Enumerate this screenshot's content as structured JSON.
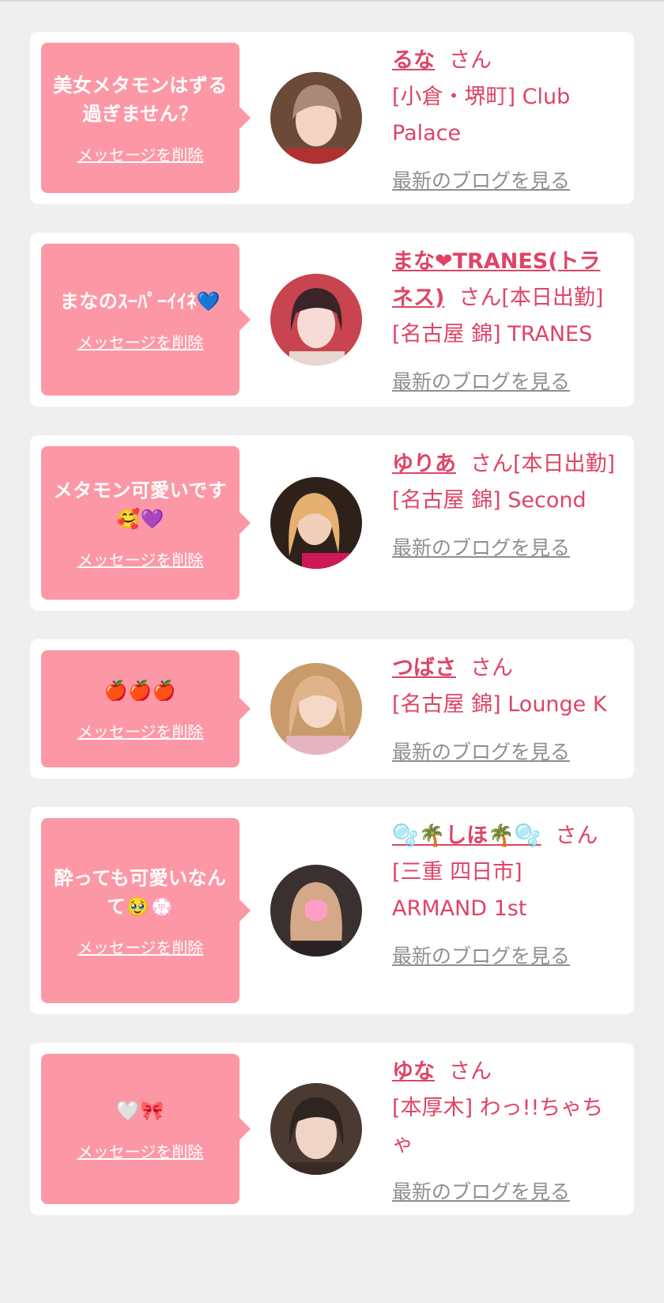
{
  "colors": {
    "bubble": "#fc98a6",
    "text": "#de4466",
    "link": "#8f8f8f",
    "background": "#efefef"
  },
  "cards": [
    {
      "message": "美女メタモンはずる過ぎません？",
      "delete": "メッセージを削除",
      "name": "るな",
      "honorific": "さん",
      "location": "[小倉・堺町] Club Palace",
      "blog": "最新のブログを見る"
    },
    {
      "message": "まなのｽｰﾊﾟｰｲｲﾈ💙",
      "delete": "メッセージを削除",
      "name": "まな❤TRANES(トラネス)",
      "honorific": "さん[本日出勤]",
      "location": "[名古屋 錦] TRANES",
      "blog": "最新のブログを見る"
    },
    {
      "message": "メタモン可愛いです🥰💜",
      "delete": "メッセージを削除",
      "name": "ゆりあ",
      "honorific": "さん[本日出勤]",
      "location": "[名古屋 錦] Second",
      "blog": "最新のブログを見る"
    },
    {
      "message": "🍎🍎🍎",
      "delete": "メッセージを削除",
      "name": "つばさ",
      "honorific": "さん",
      "location": "[名古屋 錦] Lounge K",
      "blog": "最新のブログを見る"
    },
    {
      "message": "酔っても可愛いなんて🥹💮",
      "delete": "メッセージを削除",
      "name": "🫧🌴しほ🌴🫧",
      "honorific": "さん",
      "location": "[三重 四日市] ARMAND 1st",
      "blog": "最新のブログを見る"
    },
    {
      "message": "🤍🎀",
      "delete": "メッセージを削除",
      "name": "ゆな",
      "honorific": "さん",
      "location": "[本厚木] わっ!!ちゃちゃ",
      "blog": "最新のブログを見る"
    }
  ]
}
